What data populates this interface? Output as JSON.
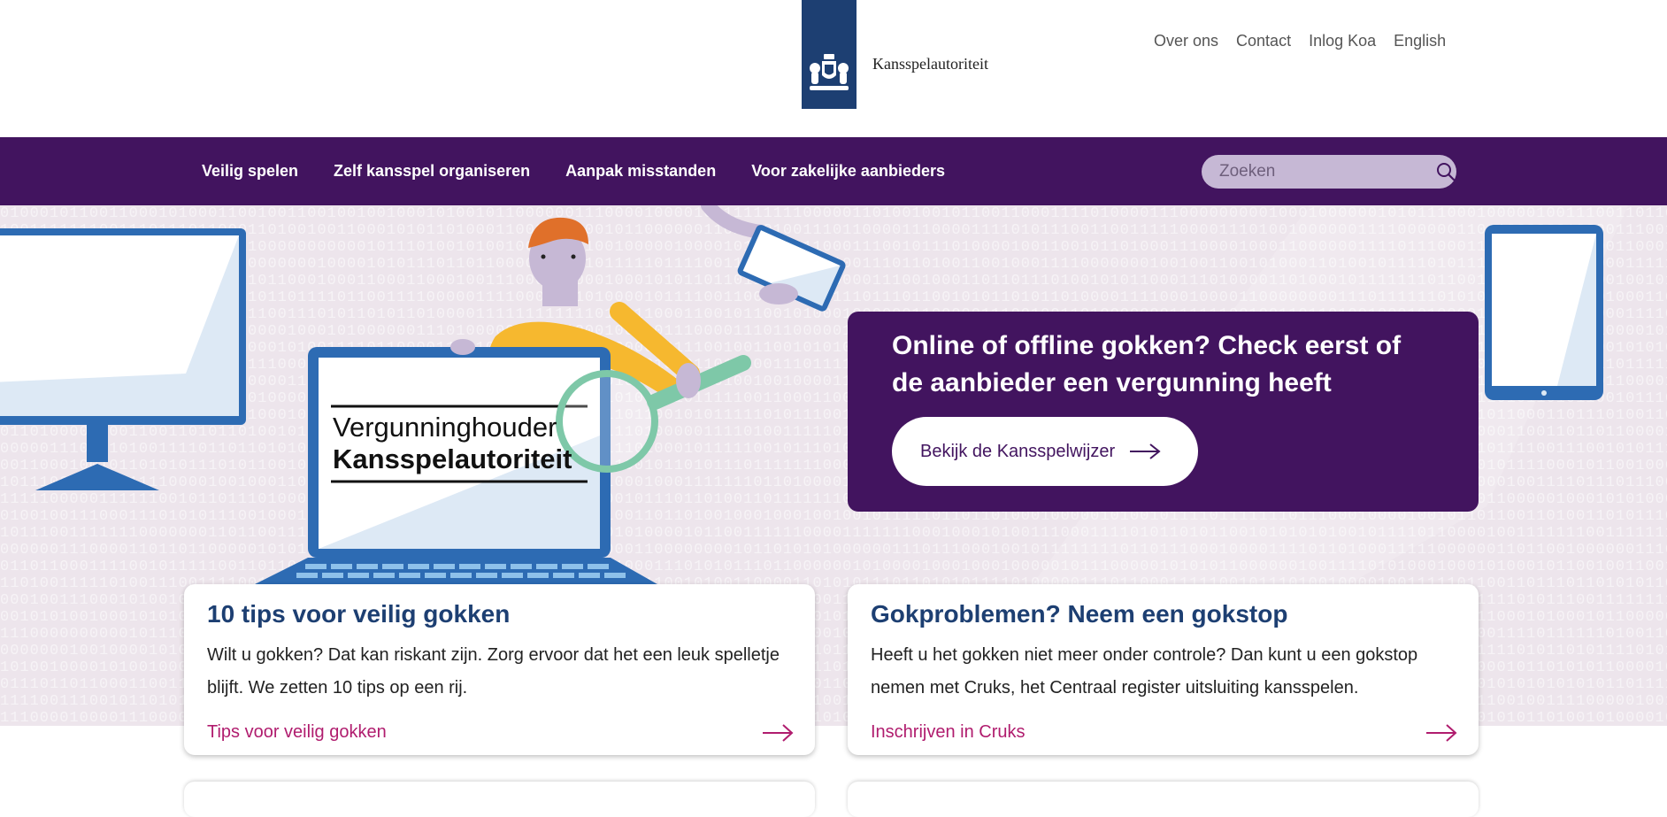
{
  "header": {
    "logo_text": "Kansspelautoriteit",
    "top_links": [
      "Over ons",
      "Contact",
      "Inlog Koa",
      "English"
    ]
  },
  "nav": {
    "items": [
      "Veilig spelen",
      "Zelf kansspel organiseren",
      "Aanpak misstanden",
      "Voor zakelijke aanbieders"
    ],
    "search_placeholder": "Zoeken"
  },
  "hero": {
    "illustration_text_line1": "Vergunninghouder",
    "illustration_text_line2": "Kansspelautoriteit",
    "callout_title": "Online of offline gokken? Check eerst of de aanbieder een vergunning heeft",
    "callout_button": "Bekijk de Kansspelwijzer"
  },
  "cards": [
    {
      "title": "10 tips voor veilig gokken",
      "text": "Wilt u gokken? Dat kan riskant zijn. Zorg ervoor dat het een leuk spelletje blijft. We zetten 10 tips op een rij.",
      "link": "Tips voor veilig gokken"
    },
    {
      "title": "Gokproblemen? Neem een gokstop",
      "text": "Heeft u het gokken niet meer onder controle? Dan kunt u een gokstop nemen met Cruks, het Centraal register uitsluiting kansspelen.",
      "link": "Inschrijven in Cruks"
    }
  ],
  "colors": {
    "brand_purple": "#42145f",
    "logo_blue": "#1d3f72",
    "link_magenta": "#b01c6e",
    "hero_bg": "#ede5ec"
  },
  "icons": {
    "search": "search-icon",
    "arrow": "arrow-right-icon"
  }
}
